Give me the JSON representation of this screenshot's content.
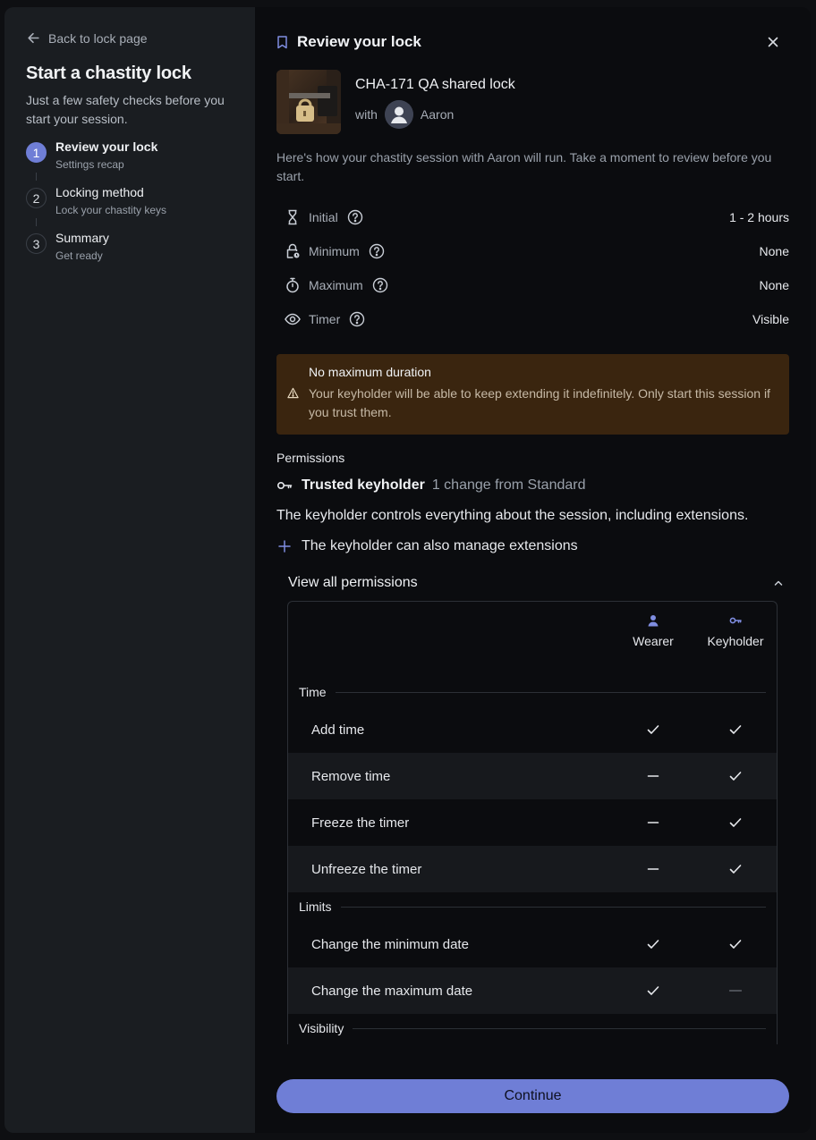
{
  "sidebar": {
    "back_label": "Back to lock page",
    "title": "Start a chastity lock",
    "subtitle": "Just a few safety checks before you start your session.",
    "steps": [
      {
        "num": "1",
        "label": "Review your lock",
        "desc": "Settings recap"
      },
      {
        "num": "2",
        "label": "Locking method",
        "desc": "Lock your chastity keys"
      },
      {
        "num": "3",
        "label": "Summary",
        "desc": "Get ready"
      }
    ]
  },
  "header": {
    "title": "Review your lock"
  },
  "lock": {
    "name": "CHA-171 QA shared lock",
    "with_label": "with",
    "keyholder": "Aaron"
  },
  "intro": "Here's how your chastity session with Aaron will run. Take a moment to review before you start.",
  "settings": [
    {
      "icon": "hourglass-icon",
      "label": "Initial",
      "value": "1 - 2 hours"
    },
    {
      "icon": "lock-clock-icon",
      "label": "Minimum",
      "value": "None"
    },
    {
      "icon": "stopwatch-icon",
      "label": "Maximum",
      "value": "None"
    },
    {
      "icon": "eye-icon",
      "label": "Timer",
      "value": "Visible"
    }
  ],
  "warning": {
    "title": "No maximum duration",
    "body": "Your keyholder will be able to keep extending it indefinitely. Only start this session if you trust them."
  },
  "permissions": {
    "heading": "Permissions",
    "profile_name": "Trusted keyholder",
    "profile_change": "1 change from Standard",
    "profile_desc": "The keyholder controls everything about the session, including extensions.",
    "extra": "The keyholder can also manage extensions",
    "view_all": "View all permissions",
    "columns": {
      "wearer": "Wearer",
      "keyholder": "Keyholder"
    },
    "sections": [
      {
        "title": "Time",
        "rows": [
          {
            "name": "Add time",
            "wearer": "check",
            "keyholder": "check"
          },
          {
            "name": "Remove time",
            "wearer": "minus",
            "keyholder": "check"
          },
          {
            "name": "Freeze the timer",
            "wearer": "minus",
            "keyholder": "check"
          },
          {
            "name": "Unfreeze the timer",
            "wearer": "minus",
            "keyholder": "check"
          }
        ]
      },
      {
        "title": "Limits",
        "rows": [
          {
            "name": "Change the minimum date",
            "wearer": "check",
            "keyholder": "check"
          },
          {
            "name": "Change the maximum date",
            "wearer": "check",
            "keyholder": "dash"
          }
        ]
      },
      {
        "title": "Visibility",
        "rows": []
      }
    ]
  },
  "footer": {
    "continue_label": "Continue"
  },
  "colors": {
    "accent": "#6f7ed6",
    "sidebar_bg": "#1a1d21",
    "warning_bg": "#3a250f"
  }
}
